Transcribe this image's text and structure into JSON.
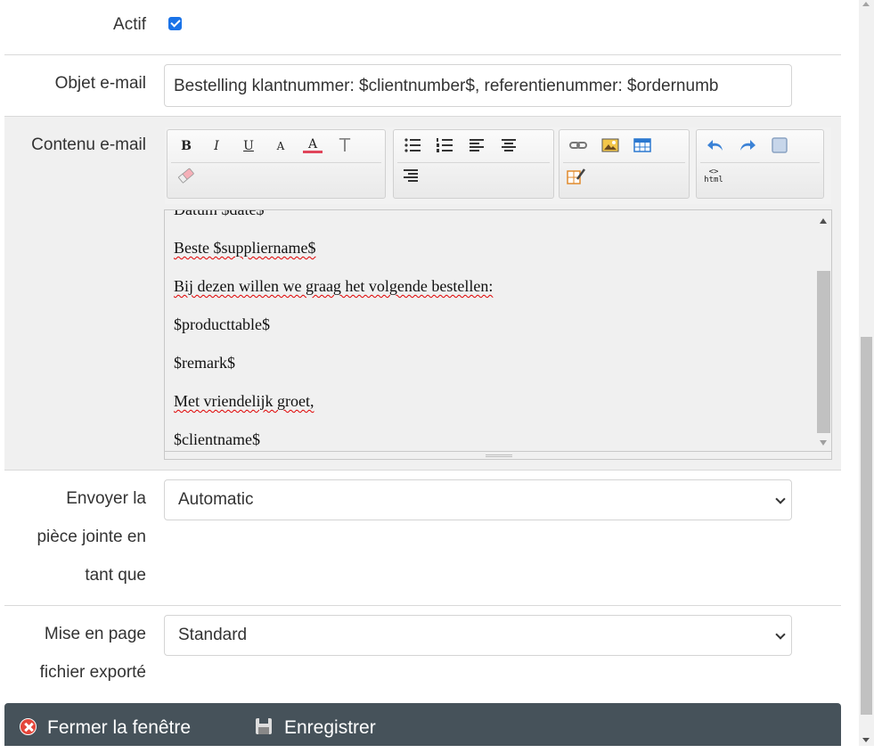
{
  "form": {
    "active": {
      "label": "Actif",
      "checked": true
    },
    "subject": {
      "label": "Objet e-mail",
      "value": "Bestelling klantnummer: $clientnumber$, referentienummer: $ordernumb"
    },
    "content": {
      "label": "Contenu e-mail",
      "lines": [
        "Datum $date$",
        "Beste $suppliername$",
        "Bij dezen willen we graag het volgende bestellen:",
        "$producttable$",
        "$remark$",
        "Met vriendelijk groet,",
        "$clientname$"
      ]
    },
    "attachment": {
      "label_line1": "Envoyer la",
      "label_line2": "pièce jointe en",
      "label_line3": "tant que",
      "selected": "Automatic"
    },
    "export_layout": {
      "label_line1": "Mise en page",
      "label_line2": "fichier exporté",
      "selected": "Standard"
    }
  },
  "toolbar": {
    "bold": "B",
    "italic": "I",
    "underline": "U",
    "font": "A",
    "font_color": "A",
    "text_style": "T",
    "html": "html",
    "html_brackets": "<>"
  },
  "footer": {
    "close_label": "Fermer la fenêtre",
    "save_label": "Enregistrer"
  },
  "colors": {
    "footer_bg": "#46525a",
    "checkbox": "#1a73e8",
    "close_icon": "#e4463a"
  }
}
